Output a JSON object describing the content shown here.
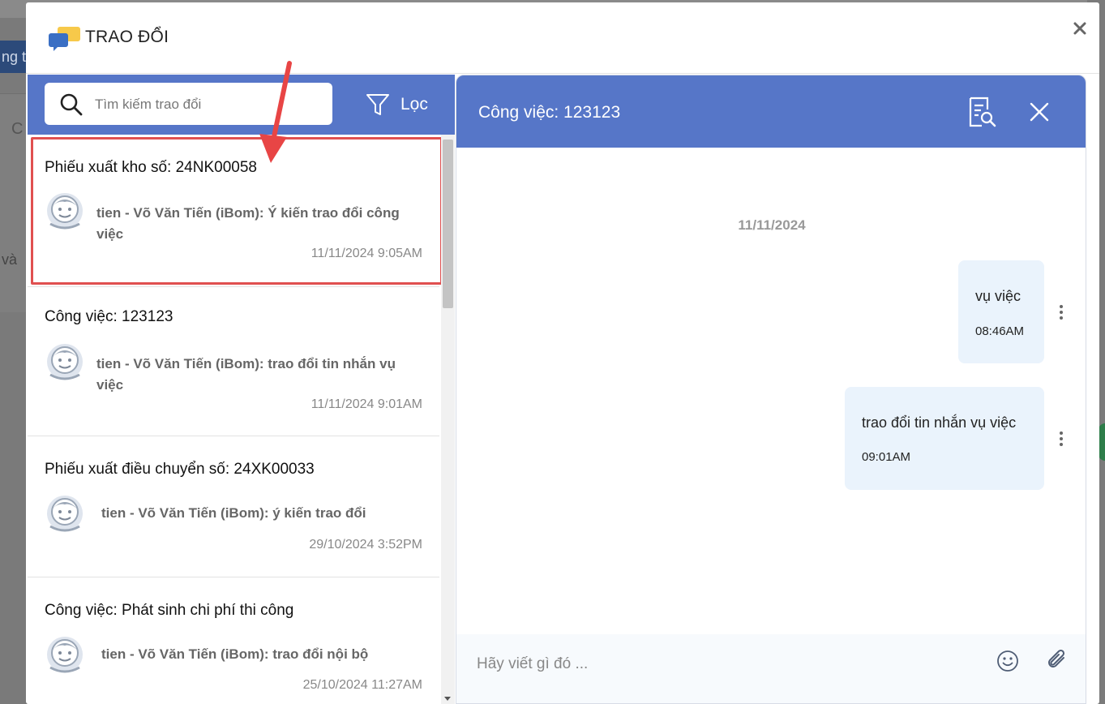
{
  "background": {
    "left_tab_text": "ng tá",
    "left_c_text": "C",
    "left_va_text": "và"
  },
  "modal": {
    "title": "TRAO ĐỔI",
    "close_label": "×"
  },
  "left_panel": {
    "search": {
      "placeholder": "Tìm kiếm trao đổi",
      "value": ""
    },
    "filter_label": "Lọc",
    "threads": [
      {
        "title": "Phiếu xuất kho số: 24NK00058",
        "message": "tien - Võ Văn Tiến (iBom): Ý kiến trao đổi công việc",
        "time": "11/11/2024 9:05AM",
        "highlighted": true
      },
      {
        "title": "Công việc: 123123",
        "message": "tien - Võ Văn Tiến (iBom): trao đổi tin nhắn vụ việc",
        "time": "11/11/2024 9:01AM",
        "highlighted": false
      },
      {
        "title": "Phiếu xuất điều chuyển số: 24XK00033",
        "message": "tien - Võ Văn Tiến (iBom): ý kiến trao đổi",
        "time": "29/10/2024 3:52PM",
        "highlighted": false
      },
      {
        "title": "Công việc: Phát sinh chi phí thi công",
        "message": "tien - Võ Văn Tiến (iBom): trao đổi nội bộ",
        "time": "25/10/2024 11:27AM",
        "highlighted": false
      }
    ]
  },
  "chat": {
    "title": "Công việc: 123123",
    "date_separator": "11/11/2024",
    "messages": [
      {
        "text": "vụ việc",
        "time": "08:46AM"
      },
      {
        "text": "trao đổi tin nhắn vụ việc",
        "time": "09:01AM"
      }
    ],
    "composer": {
      "placeholder": "Hãy viết gì đó ...",
      "value": ""
    }
  },
  "colors": {
    "header_blue": "#5676c8",
    "bubble_bg": "#eaf3fc",
    "highlight_red": "#e05050",
    "logo_yellow": "#f7c94a",
    "logo_blue": "#3a6fc4"
  },
  "icons": {
    "logo": "chat-bubbles-icon",
    "search": "search-icon",
    "filter": "funnel-icon",
    "avatar": "user-avatar-icon",
    "doc_search": "document-search-icon",
    "close": "close-icon",
    "more": "kebab-menu-icon",
    "emoji": "smiley-icon",
    "attach": "paperclip-icon"
  }
}
